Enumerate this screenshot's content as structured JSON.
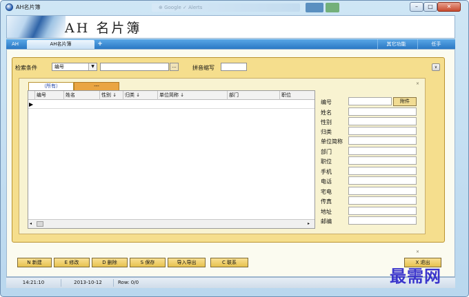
{
  "window": {
    "title": "AH名片簿",
    "blurred_title": "⊕ Google  ✓  Alerts",
    "min_label": "–",
    "max_label": "□",
    "close_label": "✕"
  },
  "banner": {
    "title": "AH 名片簿"
  },
  "tabs": {
    "ah": "AH",
    "book": "AH名片簿",
    "add": "+",
    "other": "其它功能",
    "helper": "任手"
  },
  "search": {
    "label": "检索条件",
    "field_value": "编号",
    "arrow": "▼",
    "input_value": "",
    "browse": "...",
    "pinyin_label": "拼音缩写",
    "pinyin_value": "",
    "collapse": "∨"
  },
  "list_tabs": {
    "all": "（所有）",
    "dash": "---"
  },
  "grid": {
    "columns": [
      "编号",
      "姓名",
      "性别 ↓",
      "归类 ↓",
      "单位简称 ↓",
      "部门",
      "职位"
    ],
    "indicator": "▶",
    "scroll_left": "◂",
    "scroll_right": "▸"
  },
  "detail": {
    "fields": [
      "编号",
      "姓名",
      "性别",
      "归类",
      "单位简称",
      "部门",
      "职位",
      "手机",
      "电话",
      "宅电",
      "传真",
      "地址",
      "邮编"
    ],
    "attach_label": "附件"
  },
  "panel_close": "×",
  "buttons": {
    "new": "N 新建",
    "edit": "E 修改",
    "delete": "D 删除",
    "save": "S 保存",
    "import_export": "导入导出",
    "contact": "C 联系",
    "exit": "X 退出"
  },
  "status": {
    "time": "14:21:10",
    "date": "2013-10-12",
    "row": "Row: 0/0"
  },
  "watermark": "最需网",
  "colors": {
    "accent_blue": "#2a78c4",
    "panel_gold": "#f5de8d",
    "tab_orange": "#eaa542",
    "watermark": "#2d27c9"
  }
}
